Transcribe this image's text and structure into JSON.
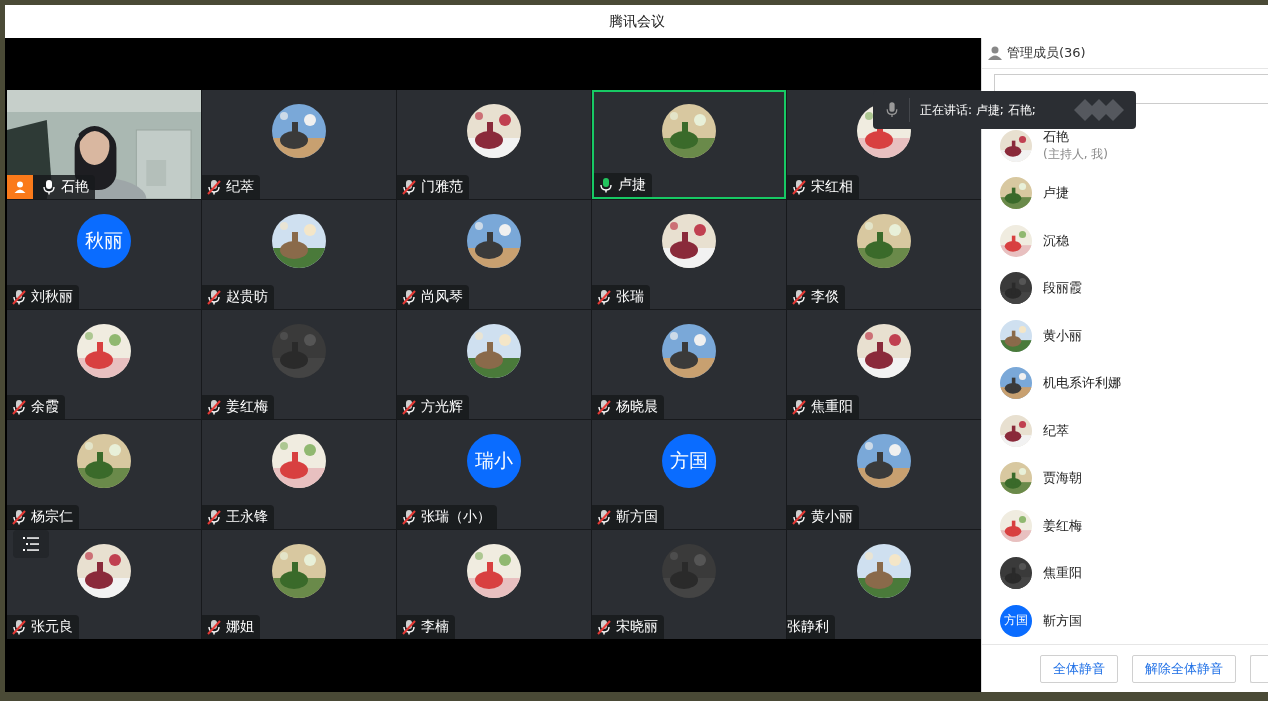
{
  "window": {
    "title": "腾讯会议"
  },
  "tiles": [
    {
      "name": "石艳",
      "kind": "video",
      "mic_icon": true,
      "muted": false,
      "speaking": false,
      "host": true
    },
    {
      "name": "纪萃",
      "kind": "picture",
      "mic_icon": true,
      "muted": true,
      "speaking": false,
      "host": false
    },
    {
      "name": "门雅范",
      "kind": "picture",
      "mic_icon": true,
      "muted": true,
      "speaking": false,
      "host": false
    },
    {
      "name": "卢捷",
      "kind": "picture",
      "mic_icon": true,
      "muted": false,
      "speaking": true,
      "host": false
    },
    {
      "name": "宋红相",
      "kind": "picture",
      "mic_icon": true,
      "muted": true,
      "speaking": false,
      "host": false
    },
    {
      "name": "刘秋丽",
      "kind": "initials",
      "initials": "秋丽",
      "mic_icon": true,
      "muted": true,
      "speaking": false,
      "host": false
    },
    {
      "name": "赵贵昉",
      "kind": "picture",
      "mic_icon": true,
      "muted": true,
      "speaking": false,
      "host": false
    },
    {
      "name": "尚风琴",
      "kind": "picture",
      "mic_icon": true,
      "muted": true,
      "speaking": false,
      "host": false
    },
    {
      "name": "张瑞",
      "kind": "picture",
      "mic_icon": true,
      "muted": true,
      "speaking": false,
      "host": false
    },
    {
      "name": "李倓",
      "kind": "picture",
      "mic_icon": true,
      "muted": true,
      "speaking": false,
      "host": false
    },
    {
      "name": "余霞",
      "kind": "picture",
      "mic_icon": true,
      "muted": true,
      "speaking": false,
      "host": false
    },
    {
      "name": "姜红梅",
      "kind": "picture",
      "mic_icon": true,
      "muted": true,
      "speaking": false,
      "host": false
    },
    {
      "name": "方光辉",
      "kind": "picture",
      "mic_icon": true,
      "muted": true,
      "speaking": false,
      "host": false
    },
    {
      "name": "杨晓晨",
      "kind": "picture",
      "mic_icon": true,
      "muted": true,
      "speaking": false,
      "host": false
    },
    {
      "name": "焦重阳",
      "kind": "picture",
      "mic_icon": true,
      "muted": true,
      "speaking": false,
      "host": false
    },
    {
      "name": "杨宗仁",
      "kind": "picture",
      "mic_icon": true,
      "muted": true,
      "speaking": false,
      "host": false
    },
    {
      "name": "王永锋",
      "kind": "picture",
      "mic_icon": true,
      "muted": true,
      "speaking": false,
      "host": false
    },
    {
      "name": "张瑞（小）",
      "kind": "initials",
      "initials": "瑞小",
      "mic_icon": true,
      "muted": true,
      "speaking": false,
      "host": false
    },
    {
      "name": "靳方国",
      "kind": "initials",
      "initials": "方国",
      "mic_icon": true,
      "muted": true,
      "speaking": false,
      "host": false
    },
    {
      "name": "黄小丽",
      "kind": "picture",
      "mic_icon": true,
      "muted": true,
      "speaking": false,
      "host": false
    },
    {
      "name": "张元良",
      "kind": "picture",
      "mic_icon": true,
      "muted": true,
      "speaking": false,
      "host": false
    },
    {
      "name": "娜姐",
      "kind": "picture",
      "mic_icon": true,
      "muted": true,
      "speaking": false,
      "host": false
    },
    {
      "name": "李楠",
      "kind": "picture",
      "mic_icon": true,
      "muted": true,
      "speaking": false,
      "host": false
    },
    {
      "name": "宋晓丽",
      "kind": "picture",
      "mic_icon": true,
      "muted": true,
      "speaking": false,
      "host": false
    },
    {
      "name": "张静利",
      "kind": "picture",
      "mic_icon": false,
      "speaking": false,
      "host": false
    }
  ],
  "speaking_banner": {
    "text": "正在讲话: 卢捷; 石艳;"
  },
  "members_panel": {
    "title": "管理成员(36)",
    "members": [
      {
        "name": "石艳",
        "note": "(主持人, 我)",
        "kind": "picture"
      },
      {
        "name": "卢捷",
        "kind": "picture"
      },
      {
        "name": "沉稳",
        "kind": "picture"
      },
      {
        "name": "段丽霞",
        "kind": "picture"
      },
      {
        "name": "黄小丽",
        "kind": "picture"
      },
      {
        "name": "机电系许利娜",
        "kind": "picture"
      },
      {
        "name": "纪萃",
        "kind": "picture"
      },
      {
        "name": "贾海朝",
        "kind": "picture"
      },
      {
        "name": "姜红梅",
        "kind": "picture"
      },
      {
        "name": "焦重阳",
        "kind": "picture"
      },
      {
        "name": "靳方国",
        "kind": "initials",
        "initials": "方国"
      }
    ],
    "buttons": [
      "全体静音",
      "解除全体静音"
    ]
  }
}
